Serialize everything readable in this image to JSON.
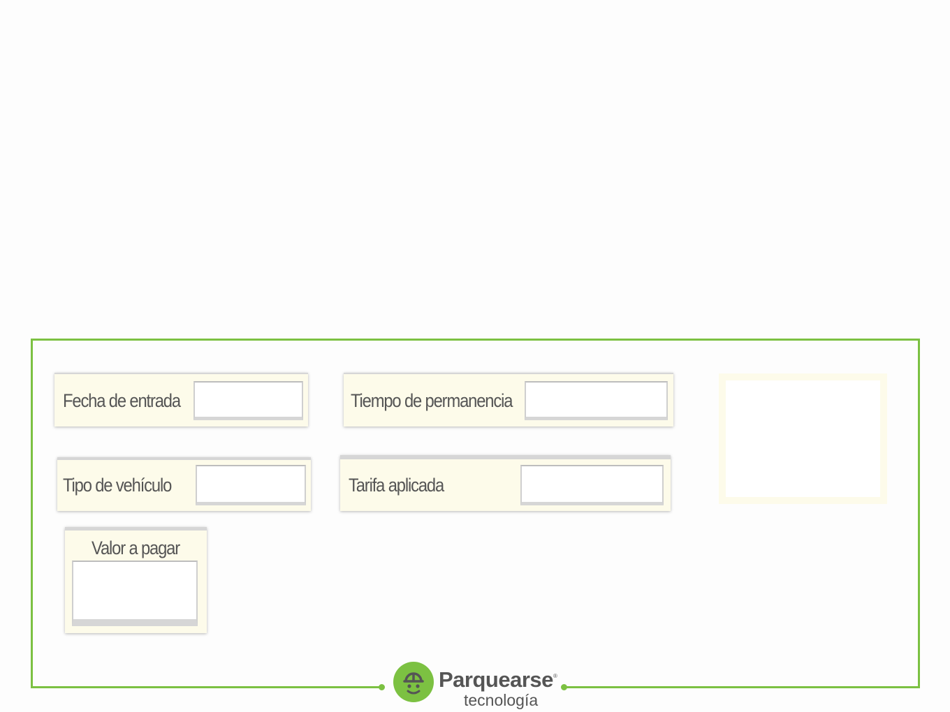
{
  "form": {
    "entry_date": {
      "label": "Fecha de entrada",
      "value": ""
    },
    "duration": {
      "label": "Tiempo de permanencia",
      "value": ""
    },
    "vehicle_type": {
      "label": "Tipo de vehículo",
      "value": ""
    },
    "rate": {
      "label": "Tarifa aplicada",
      "value": ""
    },
    "amount_due": {
      "label": "Valor a pagar",
      "value": ""
    }
  },
  "brand": {
    "name": "Parquearse",
    "tagline": "tecnología",
    "registered_mark": "®",
    "accent_color": "#7cc142",
    "text_color": "#555555",
    "panel_color": "#fdfbea",
    "icon": "parking-mascot-icon"
  }
}
